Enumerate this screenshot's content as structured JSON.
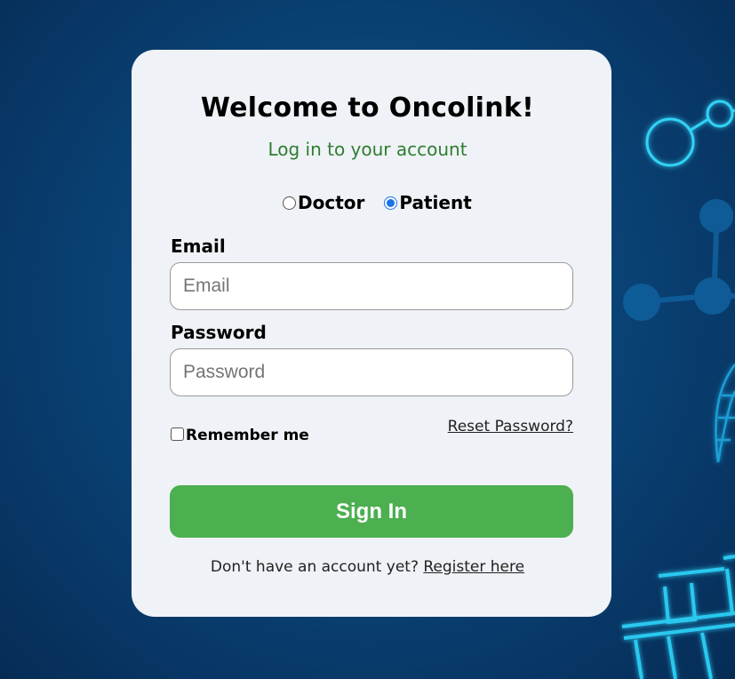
{
  "header": {
    "title": "Welcome to Oncolink!",
    "subtitle": "Log in to your account"
  },
  "role": {
    "options": [
      {
        "label": "Doctor",
        "checked": false
      },
      {
        "label": "Patient",
        "checked": true
      }
    ]
  },
  "form": {
    "email_label": "Email",
    "email_placeholder": "Email",
    "email_value": "",
    "password_label": "Password",
    "password_placeholder": "Password",
    "password_value": "",
    "remember_label": "Remember me",
    "remember_checked": false,
    "reset_link": "Reset Password?",
    "signin_label": "Sign In"
  },
  "footer": {
    "prompt": "Don't have an account yet?",
    "register_link": "Register here"
  },
  "colors": {
    "background": "#0a4478",
    "card": "#eff2f6",
    "subtitle": "#2f7d32",
    "button": "#4caf50",
    "radio_selected": "#1a73e8",
    "glow": "#27c6f0"
  },
  "icons": {
    "background_decor": [
      "molecule-icon",
      "test-tube-icon"
    ]
  }
}
